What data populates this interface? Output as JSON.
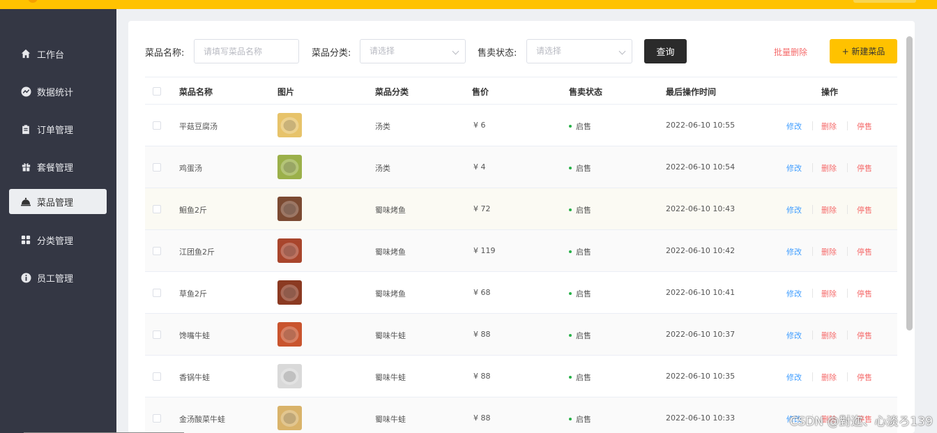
{
  "sidebar": {
    "items": [
      {
        "label": "工作台",
        "icon": "home-icon",
        "active": false
      },
      {
        "label": "数据统计",
        "icon": "chart-icon",
        "active": false
      },
      {
        "label": "订单管理",
        "icon": "clipboard-icon",
        "active": false
      },
      {
        "label": "套餐管理",
        "icon": "gift-icon",
        "active": false
      },
      {
        "label": "菜品管理",
        "icon": "dish-cover-icon",
        "active": true
      },
      {
        "label": "分类管理",
        "icon": "grid-icon",
        "active": false
      },
      {
        "label": "员工管理",
        "icon": "info-icon",
        "active": false
      }
    ]
  },
  "filters": {
    "name_label": "菜品名称:",
    "name_placeholder": "请填写菜品名称",
    "category_label": "菜品分类:",
    "category_placeholder": "请选择",
    "status_label": "售卖状态:",
    "status_placeholder": "请选择",
    "query_button": "查询",
    "batch_delete": "批量删除",
    "new_button": "+ 新建菜品"
  },
  "table": {
    "headers": {
      "name": "菜品名称",
      "image": "图片",
      "category": "菜品分类",
      "price": "售价",
      "status": "售卖状态",
      "updated": "最后操作时间",
      "actions": "操作"
    },
    "rows": [
      {
        "name": "平菇豆腐汤",
        "category": "汤类",
        "price": "¥ 6",
        "status": "启售",
        "updated": "2022-06-10 10:55",
        "edit": "修改",
        "delete": "删除",
        "stop": "停售",
        "thumb": "#e7c36a"
      },
      {
        "name": "鸡蛋汤",
        "category": "汤类",
        "price": "¥ 4",
        "status": "启售",
        "updated": "2022-06-10 10:54",
        "edit": "修改",
        "delete": "删除",
        "stop": "停售",
        "thumb": "#9bb04a"
      },
      {
        "name": "鮰鱼2斤",
        "category": "蜀味烤鱼",
        "price": "¥ 72",
        "status": "启售",
        "updated": "2022-06-10 10:43",
        "edit": "修改",
        "delete": "删除",
        "stop": "停售",
        "thumb": "#7b4a32"
      },
      {
        "name": "江团鱼2斤",
        "category": "蜀味烤鱼",
        "price": "¥ 119",
        "status": "启售",
        "updated": "2022-06-10 10:42",
        "edit": "修改",
        "delete": "删除",
        "stop": "停售",
        "thumb": "#a8452c"
      },
      {
        "name": "草鱼2斤",
        "category": "蜀味烤鱼",
        "price": "¥ 68",
        "status": "启售",
        "updated": "2022-06-10 10:41",
        "edit": "修改",
        "delete": "删除",
        "stop": "停售",
        "thumb": "#8b3a22"
      },
      {
        "name": "馋嘴牛蛙",
        "category": "蜀味牛蛙",
        "price": "¥ 88",
        "status": "启售",
        "updated": "2022-06-10 10:37",
        "edit": "修改",
        "delete": "删除",
        "stop": "停售",
        "thumb": "#c9542e"
      },
      {
        "name": "香锅牛蛙",
        "category": "蜀味牛蛙",
        "price": "¥ 88",
        "status": "启售",
        "updated": "2022-06-10 10:35",
        "edit": "修改",
        "delete": "删除",
        "stop": "停售",
        "thumb": "#d9d9d9"
      },
      {
        "name": "金汤酸菜牛蛙",
        "category": "蜀味牛蛙",
        "price": "¥ 88",
        "status": "启售",
        "updated": "2022-06-10 10:33",
        "edit": "修改",
        "delete": "删除",
        "stop": "停售",
        "thumb": "#d9b36a"
      }
    ]
  },
  "watermark": "CSDN @對迩、心淡ろ139",
  "colors": {
    "accent": "#ffc200",
    "sidebar": "#343744",
    "link_blue": "#419eff",
    "danger": "#f56c6c",
    "status_green": "#27b148"
  }
}
